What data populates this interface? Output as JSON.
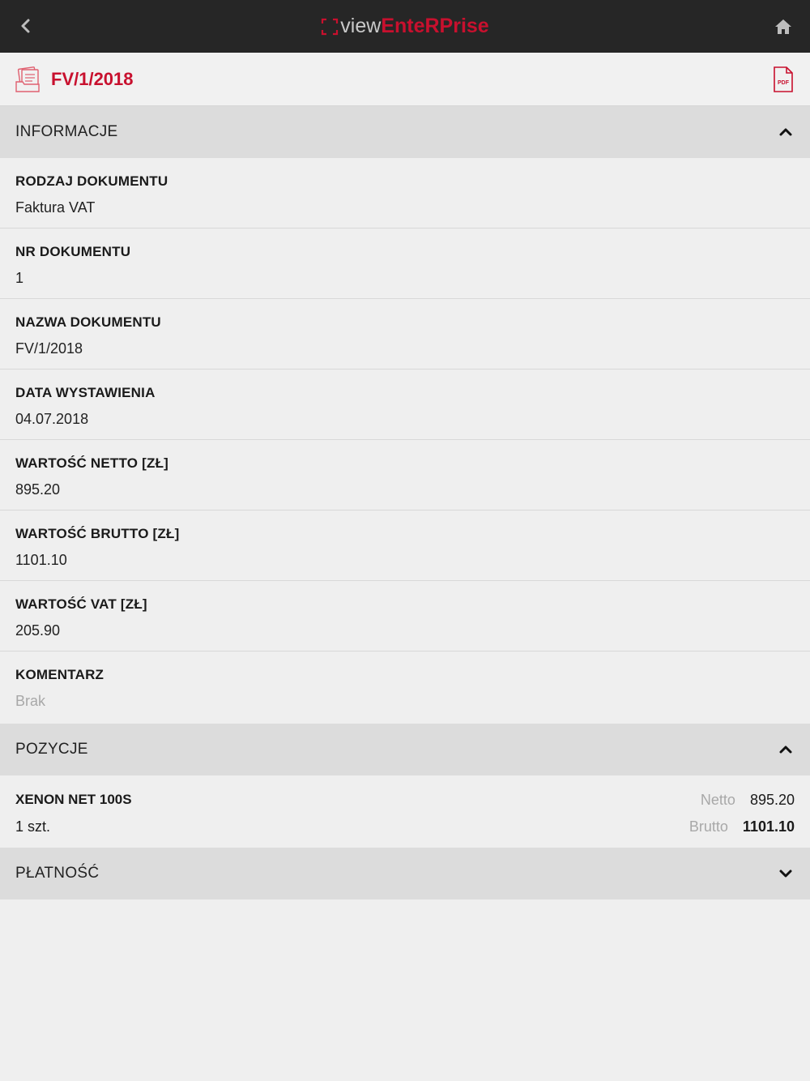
{
  "header": {
    "logo_view": "view",
    "logo_brand": "EnteRPrise",
    "back_icon": "chevron-left-icon",
    "home_icon": "home-icon"
  },
  "document": {
    "title": "FV/1/2018",
    "pdf_icon_label": "PDF"
  },
  "sections": {
    "info_title": "INFORMACJE",
    "positions_title": "POZYCJE",
    "payment_title": "PŁATNOŚĆ"
  },
  "fields": [
    {
      "label": "RODZAJ DOKUMENTU",
      "value": "Faktura VAT"
    },
    {
      "label": "NR DOKUMENTU",
      "value": "1"
    },
    {
      "label": "NAZWA DOKUMENTU",
      "value": "FV/1/2018"
    },
    {
      "label": "DATA WYSTAWIENIA",
      "value": "04.07.2018"
    },
    {
      "label": "WARTOŚĆ NETTO [ZŁ]",
      "value": "895.20"
    },
    {
      "label": "WARTOŚĆ BRUTTO [ZŁ]",
      "value": "1101.10"
    },
    {
      "label": "WARTOŚĆ VAT [ZŁ]",
      "value": "205.90"
    },
    {
      "label": "KOMENTARZ",
      "value": "Brak"
    }
  ],
  "positions": [
    {
      "name": "XENON NET 100S",
      "qty": "1 szt.",
      "netto_label": "Netto",
      "netto": "895.20",
      "brutto_label": "Brutto",
      "brutto": "1101.10"
    }
  ],
  "colors": {
    "accent": "#c8102e",
    "header_bg": "#262626",
    "section_bg": "#dcdcdc",
    "page_bg": "#efefef"
  }
}
